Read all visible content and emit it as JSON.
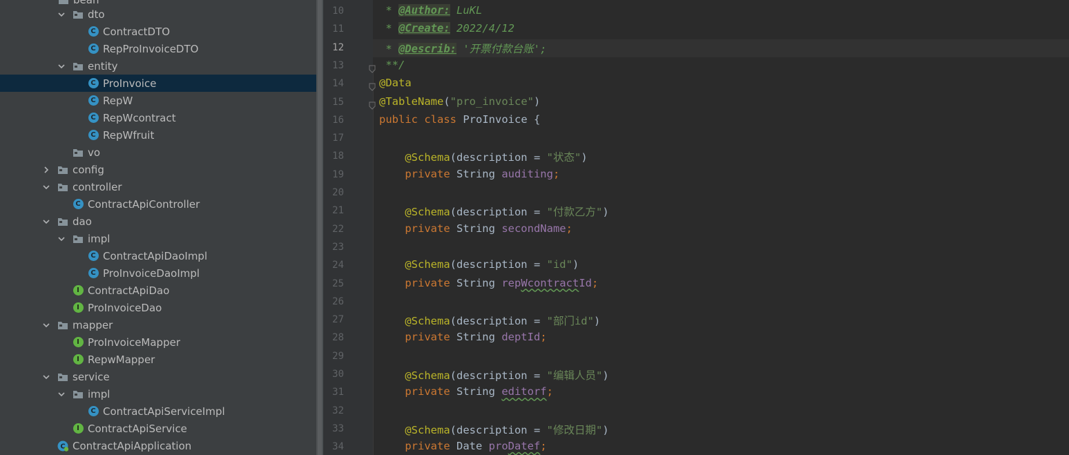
{
  "tree": {
    "top_partial_label": "bean",
    "items": [
      {
        "label": "dto",
        "type": "folder",
        "expanded": true
      },
      {
        "label": "ContractDTO",
        "type": "class"
      },
      {
        "label": "RepProInvoiceDTO",
        "type": "class"
      },
      {
        "label": "entity",
        "type": "folder",
        "expanded": true
      },
      {
        "label": "ProInvoice",
        "type": "class",
        "selected": true
      },
      {
        "label": "RepW",
        "type": "class"
      },
      {
        "label": "RepWcontract",
        "type": "class"
      },
      {
        "label": "RepWfruit",
        "type": "class"
      },
      {
        "label": "vo",
        "type": "folder"
      },
      {
        "label": "config",
        "type": "folder",
        "expanded": false
      },
      {
        "label": "controller",
        "type": "folder",
        "expanded": true
      },
      {
        "label": "ContractApiController",
        "type": "class"
      },
      {
        "label": "dao",
        "type": "folder",
        "expanded": true
      },
      {
        "label": "impl",
        "type": "folder",
        "expanded": true
      },
      {
        "label": "ContractApiDaoImpl",
        "type": "class"
      },
      {
        "label": "ProInvoiceDaoImpl",
        "type": "class"
      },
      {
        "label": "ContractApiDao",
        "type": "interface"
      },
      {
        "label": "ProInvoiceDao",
        "type": "interface"
      },
      {
        "label": "mapper",
        "type": "folder",
        "expanded": true
      },
      {
        "label": "ProInvoiceMapper",
        "type": "interface"
      },
      {
        "label": "RepwMapper",
        "type": "interface"
      },
      {
        "label": "service",
        "type": "folder",
        "expanded": true
      },
      {
        "label": "impl",
        "type": "folder",
        "expanded": true
      },
      {
        "label": "ContractApiServiceImpl",
        "type": "class"
      },
      {
        "label": "ContractApiService",
        "type": "interface"
      },
      {
        "label": "ContractApiApplication",
        "type": "spring-class"
      }
    ]
  },
  "editor": {
    "current_line": 12,
    "lines": [
      {
        "n": "10",
        "tokens": [
          [
            " * ",
            "doc"
          ],
          [
            "@Author:",
            "tag"
          ],
          [
            " LuKL",
            "doc"
          ]
        ]
      },
      {
        "n": "11",
        "tokens": [
          [
            " * ",
            "doc"
          ],
          [
            "@Create:",
            "tag"
          ],
          [
            " 2022/4/12",
            "doc"
          ]
        ]
      },
      {
        "n": "12",
        "tokens": [
          [
            " * ",
            "doc"
          ],
          [
            "@Describ:",
            "tag"
          ],
          [
            " '开票付款台账';",
            "doc"
          ]
        ]
      },
      {
        "n": "13",
        "tokens": [
          [
            " **/",
            "doc"
          ]
        ]
      },
      {
        "n": "14",
        "tokens": [
          [
            "@Data",
            "ann"
          ]
        ]
      },
      {
        "n": "15",
        "tokens": [
          [
            "@TableName",
            "ann"
          ],
          [
            "(",
            ""
          ],
          [
            "\"pro_invoice\"",
            "str"
          ],
          [
            ")",
            ""
          ]
        ]
      },
      {
        "n": "16",
        "tokens": [
          [
            "public ",
            "kw"
          ],
          [
            "class ",
            "kw"
          ],
          [
            "ProInvoice {",
            ""
          ]
        ]
      },
      {
        "n": "17",
        "tokens": []
      },
      {
        "n": "18",
        "tokens": [
          [
            "    ",
            ""
          ],
          [
            "@Schema",
            "ann"
          ],
          [
            "(description = ",
            ""
          ],
          [
            "\"状态\"",
            "str"
          ],
          [
            ")",
            ""
          ]
        ]
      },
      {
        "n": "19",
        "tokens": [
          [
            "    ",
            ""
          ],
          [
            "private ",
            "kw"
          ],
          [
            "String ",
            ""
          ],
          [
            "auditing",
            "fld"
          ],
          [
            ";",
            "kw"
          ]
        ]
      },
      {
        "n": "20",
        "tokens": []
      },
      {
        "n": "21",
        "tokens": [
          [
            "    ",
            ""
          ],
          [
            "@Schema",
            "ann"
          ],
          [
            "(description = ",
            ""
          ],
          [
            "\"付款乙方\"",
            "str"
          ],
          [
            ")",
            ""
          ]
        ]
      },
      {
        "n": "22",
        "tokens": [
          [
            "    ",
            ""
          ],
          [
            "private ",
            "kw"
          ],
          [
            "String ",
            ""
          ],
          [
            "secondName",
            "fld"
          ],
          [
            ";",
            "kw"
          ]
        ]
      },
      {
        "n": "23",
        "tokens": []
      },
      {
        "n": "24",
        "tokens": [
          [
            "    ",
            ""
          ],
          [
            "@Schema",
            "ann"
          ],
          [
            "(description = ",
            ""
          ],
          [
            "\"id\"",
            "str"
          ],
          [
            ")",
            ""
          ]
        ]
      },
      {
        "n": "25",
        "tokens": [
          [
            "    ",
            ""
          ],
          [
            "private ",
            "kw"
          ],
          [
            "String ",
            ""
          ],
          [
            "rep",
            "fld"
          ],
          [
            "Wcontract",
            "fld wavy"
          ],
          [
            "Id",
            "fld"
          ],
          [
            ";",
            "kw"
          ]
        ]
      },
      {
        "n": "26",
        "tokens": []
      },
      {
        "n": "27",
        "tokens": [
          [
            "    ",
            ""
          ],
          [
            "@Schema",
            "ann"
          ],
          [
            "(description = ",
            ""
          ],
          [
            "\"部门id\"",
            "str"
          ],
          [
            ")",
            ""
          ]
        ]
      },
      {
        "n": "28",
        "tokens": [
          [
            "    ",
            ""
          ],
          [
            "private ",
            "kw"
          ],
          [
            "String ",
            ""
          ],
          [
            "deptId",
            "fld"
          ],
          [
            ";",
            "kw"
          ]
        ]
      },
      {
        "n": "29",
        "tokens": []
      },
      {
        "n": "30",
        "tokens": [
          [
            "    ",
            ""
          ],
          [
            "@Schema",
            "ann"
          ],
          [
            "(description = ",
            ""
          ],
          [
            "\"编辑人员\"",
            "str"
          ],
          [
            ")",
            ""
          ]
        ]
      },
      {
        "n": "31",
        "tokens": [
          [
            "    ",
            ""
          ],
          [
            "private ",
            "kw"
          ],
          [
            "String ",
            ""
          ],
          [
            "editorf",
            "fld wavy"
          ],
          [
            ";",
            "kw"
          ]
        ]
      },
      {
        "n": "32",
        "tokens": []
      },
      {
        "n": "33",
        "tokens": [
          [
            "    ",
            ""
          ],
          [
            "@Schema",
            "ann"
          ],
          [
            "(description = ",
            ""
          ],
          [
            "\"修改日期\"",
            "str"
          ],
          [
            ")",
            ""
          ]
        ]
      },
      {
        "n": "34",
        "tokens": [
          [
            "    ",
            ""
          ],
          [
            "private ",
            "kw"
          ],
          [
            "Date ",
            ""
          ],
          [
            "pro",
            "fld"
          ],
          [
            "Datef",
            "fld wavy"
          ],
          [
            ";",
            "kw"
          ]
        ]
      }
    ]
  },
  "colors": {
    "tree_bg": "#3c3f41",
    "selection": "#0d293e",
    "editor_bg": "#2b2b2b",
    "keyword": "#cc7832",
    "annotation": "#bbb529",
    "string": "#6a8759",
    "field": "#9876aa",
    "doc": "#629755",
    "class_icon": "#3592c4",
    "interface_icon": "#62b543"
  }
}
